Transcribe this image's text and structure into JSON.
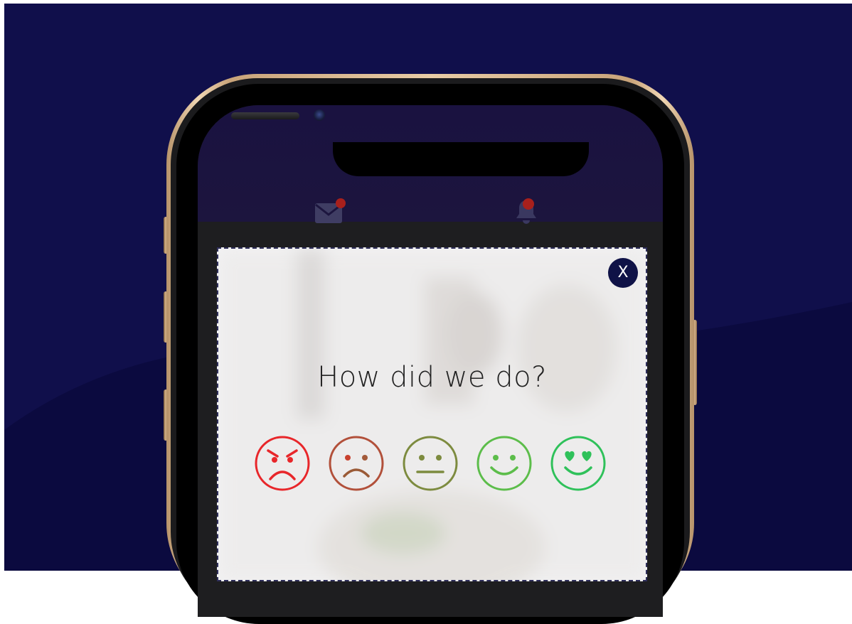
{
  "popup": {
    "title": "How did we do?",
    "close_label": "X"
  },
  "header": {
    "mail_icon": "mail-icon",
    "bell_icon": "bell-icon"
  },
  "rating": {
    "options": [
      {
        "icon": "angry-face-icon",
        "color": "#e8262a"
      },
      {
        "icon": "sad-face-icon",
        "color": "#b2503a"
      },
      {
        "icon": "neutral-face-icon",
        "color": "#7d8b3f"
      },
      {
        "icon": "smiling-face-icon",
        "color": "#5cbd4a"
      },
      {
        "icon": "heart-eyes-face-icon",
        "color": "#2fc15a"
      }
    ]
  },
  "colors": {
    "background": "#100f4b",
    "close_button": "#0f1247",
    "notification_dot": "#a8201c"
  }
}
